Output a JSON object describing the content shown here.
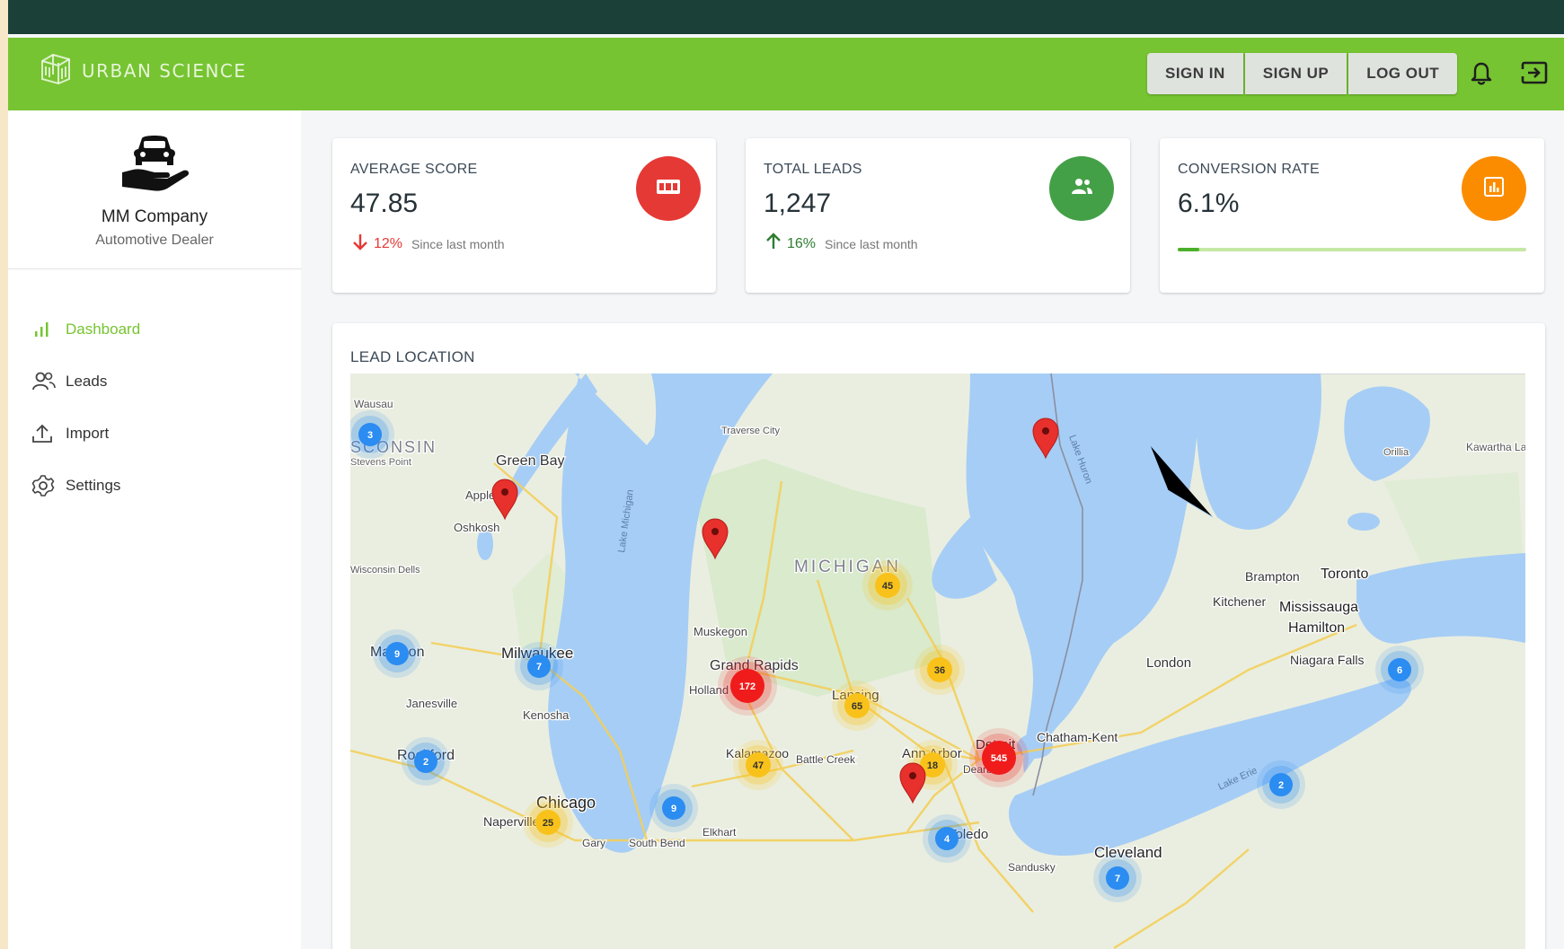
{
  "app": {
    "brand": "URBAN SCIENCE",
    "auth_buttons": [
      "SIGN IN",
      "SIGN UP",
      "LOG OUT"
    ],
    "icons": {
      "logo": "building-icon",
      "notifications": "bell-icon",
      "logout": "exit-icon"
    }
  },
  "sidebar": {
    "company_name": "MM Company",
    "company_type": "Automotive Dealer",
    "items": [
      {
        "label": "Dashboard",
        "icon": "bar-chart-icon",
        "active": true
      },
      {
        "label": "Leads",
        "icon": "people-icon",
        "active": false
      },
      {
        "label": "Import",
        "icon": "upload-icon",
        "active": false
      },
      {
        "label": "Settings",
        "icon": "gear-icon",
        "active": false
      }
    ]
  },
  "stats": [
    {
      "title": "AVERAGE SCORE",
      "value": "47.85",
      "change": "12%",
      "direction": "down",
      "since": "Since last month",
      "color": "#e53935",
      "icon": "scoreboard-icon"
    },
    {
      "title": "TOTAL LEADS",
      "value": "1,247",
      "change": "16%",
      "direction": "up",
      "since": "Since last month",
      "color": "#43a047",
      "icon": "people-icon"
    },
    {
      "title": "CONVERSION RATE",
      "value": "6.1%",
      "progress": 0.061,
      "color": "#fb8c00",
      "icon": "chart-icon"
    }
  ],
  "map": {
    "title": "LEAD LOCATION",
    "labels": {
      "wausau": "Wausau",
      "wisconsin": "SCONSIN",
      "stevens_point": "Stevens Point",
      "green_bay": "Green Bay",
      "appleton": "Appleton",
      "oshkosh": "Oshkosh",
      "wisconsin_dells": "Wisconsin Dells",
      "madison": "Madison",
      "milwaukee": "Milwaukee",
      "janesville": "Janesville",
      "kenosha": "Kenosha",
      "rockford": "Rockford",
      "chicago": "Chicago",
      "naperville": "Naperville",
      "gary": "Gary",
      "south_bend": "South Bend",
      "elkhart": "Elkhart",
      "lake_michigan": "Lake Michigan",
      "traverse_city": "Traverse City",
      "michigan": "MICHIGAN",
      "muskegon": "Muskegon",
      "grand_rapids": "Grand Rapids",
      "holland": "Holland",
      "lansing": "Lansing",
      "kalamazoo": "Kalamazoo",
      "battle_creek": "Battle Creek",
      "ann_arbor": "Ann Arbor",
      "detroit": "Detroit",
      "dearborn": "Dearborn",
      "toledo": "Toledo",
      "sandusky": "Sandusky",
      "cleveland": "Cleveland",
      "lake_huron": "Lake Huron",
      "lake_erie": "Lake Erie",
      "chatham_kent": "Chatham-Kent",
      "london": "London",
      "kitchener": "Kitchener",
      "brampton": "Brampton",
      "toronto": "Toronto",
      "mississauga": "Mississauga",
      "hamilton": "Hamilton",
      "niagara_falls": "Niagara Falls",
      "orillia": "Orillia",
      "kawartha_lakes": "Kawartha Lakes"
    },
    "clusters": [
      {
        "count": "3",
        "color": "blue"
      },
      {
        "count": "9",
        "color": "blue"
      },
      {
        "count": "7",
        "color": "blue"
      },
      {
        "count": "2",
        "color": "blue"
      },
      {
        "count": "9",
        "color": "blue"
      },
      {
        "count": "4",
        "color": "blue"
      },
      {
        "count": "2",
        "color": "blue"
      },
      {
        "count": "7",
        "color": "blue"
      },
      {
        "count": "6",
        "color": "blue"
      },
      {
        "count": "45",
        "color": "yellow"
      },
      {
        "count": "36",
        "color": "yellow"
      },
      {
        "count": "65",
        "color": "yellow"
      },
      {
        "count": "47",
        "color": "yellow"
      },
      {
        "count": "18",
        "color": "yellow"
      },
      {
        "count": "25",
        "color": "yellow"
      },
      {
        "count": "172",
        "color": "red"
      },
      {
        "count": "545",
        "color": "red"
      }
    ],
    "pin_count": 4
  }
}
